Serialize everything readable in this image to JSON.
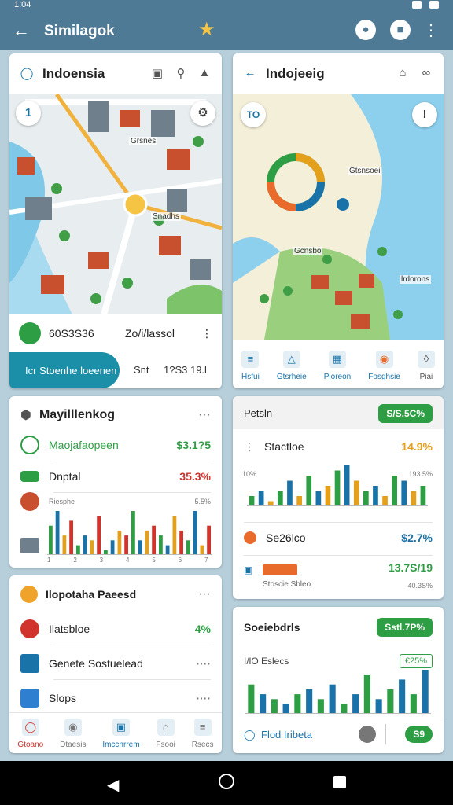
{
  "status_bar": {
    "time": "1:04"
  },
  "app_bar": {
    "title": "Similagok",
    "back_icon": "arrow-back-icon",
    "star_icon": "star-icon"
  },
  "left_map": {
    "title": "Indoensia",
    "badge": "1",
    "labels": [
      "Grsnes",
      "Snadhs"
    ],
    "info_left": "60S3S36",
    "info_right": "Zo/i/lassol",
    "pill_label": "Icr Stoenhe loeenen",
    "aside_1": "Snt",
    "aside_2": "1?S3 19.l"
  },
  "right_map": {
    "title": "Indojeeig",
    "badge": "!",
    "labels": [
      "Gtsnsoei",
      "Gcnsbo",
      "lrdorons"
    ],
    "tabs": [
      {
        "label": "Hsfui",
        "icon": "list-icon"
      },
      {
        "label": "Gtsrheie",
        "icon": "map-pin-icon"
      },
      {
        "label": "Pioreon",
        "icon": "calendar-icon"
      },
      {
        "label": "Fosghsie",
        "icon": "compass-icon"
      },
      {
        "label": "Piai",
        "icon": "shield-icon"
      }
    ]
  },
  "card_left_1": {
    "title": "Mayilllenkog",
    "more": "···",
    "rows": [
      {
        "label": "Maojafaopeen",
        "value": "$3.1?5",
        "color": "#2e9e45"
      },
      {
        "label": "Dnptal",
        "value": "35.3%",
        "color": "#d0342c"
      },
      {
        "label": "Riesphe",
        "value": "5.5%",
        "color": "#777777"
      }
    ],
    "chart_data": {
      "type": "bar",
      "values": [
        6,
        9,
        4,
        7,
        2,
        4,
        3,
        8,
        1,
        3,
        5,
        4,
        9,
        3,
        5,
        6,
        4,
        2,
        8,
        5,
        3,
        9,
        2,
        6
      ],
      "colors": [
        "#2e9e45",
        "#1a73a8",
        "#e4a01b",
        "#d0342c"
      ],
      "ticks": [
        "1",
        "2",
        "3",
        "4",
        "5",
        "6",
        "7"
      ]
    }
  },
  "card_left_2": {
    "title": "Ilopotaha Paeesd",
    "more": "···",
    "rows": [
      {
        "label": "Ilatsbloe",
        "value": "4%"
      },
      {
        "label": "Genete Sostuelead",
        "value": "····"
      },
      {
        "label": "Slops",
        "value": "····"
      }
    ],
    "tabs": [
      {
        "label": "Gtoano",
        "icon": "globe-icon"
      },
      {
        "label": "Dtaesis",
        "icon": "compass-icon"
      },
      {
        "label": "Imccnrrem",
        "icon": "image-icon"
      },
      {
        "label": "Fsooi",
        "icon": "home-icon"
      },
      {
        "label": "Rsecs",
        "icon": "menu-icon"
      }
    ]
  },
  "card_right_1": {
    "title": "Petsln",
    "chip": "S/S.5C%",
    "rows": [
      {
        "label": "Stactloe",
        "value": "14.9%",
        "color": "#e4a01b"
      },
      {
        "label": "Se26lco",
        "value": "$2.7%",
        "color": "#1a73a8"
      },
      {
        "label": "Stoscie Sbleo",
        "value": "13.7S/19",
        "color": "#2e9e45"
      }
    ],
    "axis": {
      "left": "10%",
      "right": "193.5%",
      "sub": "40.3S%"
    },
    "chart_data": {
      "type": "bar",
      "values": [
        2,
        3,
        1,
        3,
        5,
        2,
        6,
        3,
        4,
        7,
        8,
        5,
        3,
        4,
        2,
        6,
        5,
        3,
        4
      ],
      "colors": [
        "#2e9e45",
        "#1a73a8",
        "#e4a01b"
      ]
    }
  },
  "card_right_2": {
    "title": "Soeiebdrls",
    "chip": "Sstl.7P%",
    "sub_label": "I/lO Eslecs",
    "sub_chip": "€25%",
    "bottom_label": "Flod Iribeta",
    "bottom_badge": "S9",
    "chart_data": {
      "type": "bar",
      "values": [
        6,
        4,
        3,
        2,
        4,
        5,
        3,
        6,
        2,
        4,
        8,
        3,
        5,
        7,
        4,
        9
      ],
      "colors": [
        "#2e9e45",
        "#1a73a8"
      ]
    }
  }
}
